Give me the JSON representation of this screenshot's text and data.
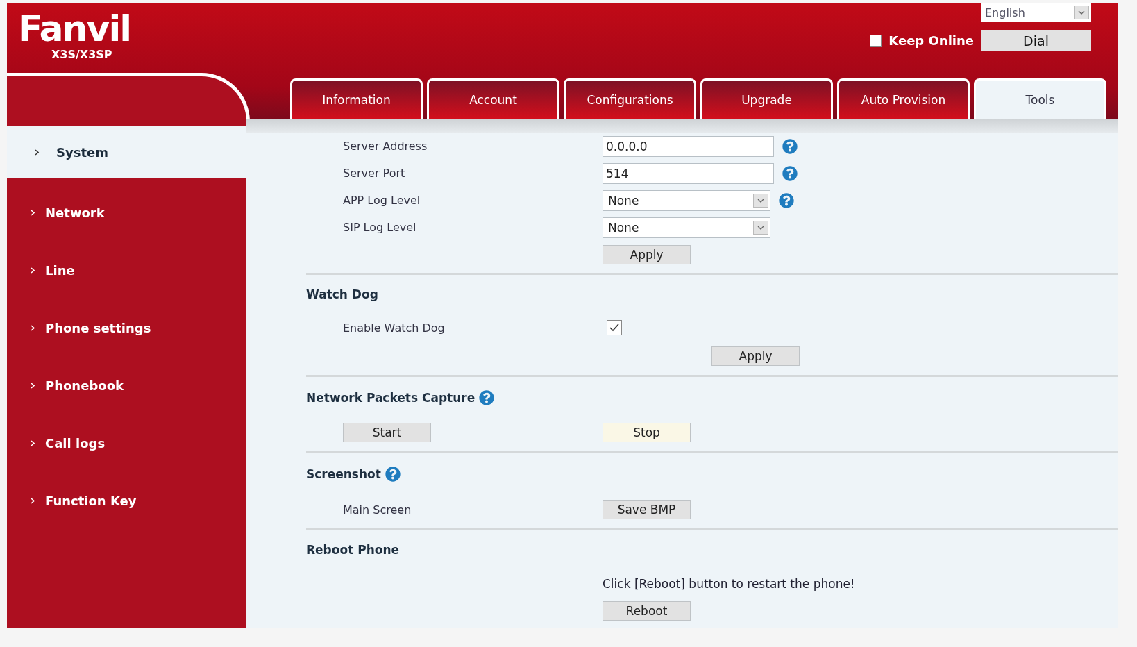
{
  "header": {
    "logo": "Fanvil",
    "model": "X3S/X3SP",
    "language": "English",
    "keep_online": {
      "label": "Keep Online",
      "checked": false
    },
    "dial_button": "Dial"
  },
  "tabs": [
    {
      "label": "Information",
      "selected": false
    },
    {
      "label": "Account",
      "selected": false
    },
    {
      "label": "Configurations",
      "selected": false
    },
    {
      "label": "Upgrade",
      "selected": false
    },
    {
      "label": "Auto Provision",
      "selected": false
    },
    {
      "label": "Tools",
      "selected": true
    }
  ],
  "sidebar": {
    "items": [
      {
        "label": "System",
        "selected": true
      },
      {
        "label": "Network",
        "selected": false
      },
      {
        "label": "Line",
        "selected": false
      },
      {
        "label": "Phone settings",
        "selected": false
      },
      {
        "label": "Phonebook",
        "selected": false
      },
      {
        "label": "Call logs",
        "selected": false
      },
      {
        "label": "Function Key",
        "selected": false
      }
    ]
  },
  "syslog": {
    "fields": [
      {
        "kind": "text",
        "label": "Server Address",
        "value": "0.0.0.0",
        "help": true
      },
      {
        "kind": "text",
        "label": "Server Port",
        "value": "514",
        "help": true
      },
      {
        "kind": "select",
        "label": "APP Log Level",
        "value": "None",
        "help": true
      },
      {
        "kind": "select",
        "label": "SIP Log Level",
        "value": "None",
        "help": false
      }
    ],
    "button": "Apply"
  },
  "watch_dog": {
    "title": "Watch Dog",
    "label": "Enable Watch Dog",
    "checked": true,
    "button": "Apply"
  },
  "packet_capture": {
    "title": "Network Packets Capture",
    "help": true,
    "buttons": [
      {
        "label": "Start",
        "highlighted": false
      },
      {
        "label": "Stop",
        "highlighted": true
      }
    ]
  },
  "screenshot": {
    "title": "Screenshot",
    "help": true,
    "label": "Main Screen",
    "button": "Save BMP"
  },
  "reboot": {
    "title": "Reboot Phone",
    "message": "Click [Reboot] button to restart the phone!",
    "button": "Reboot"
  }
}
